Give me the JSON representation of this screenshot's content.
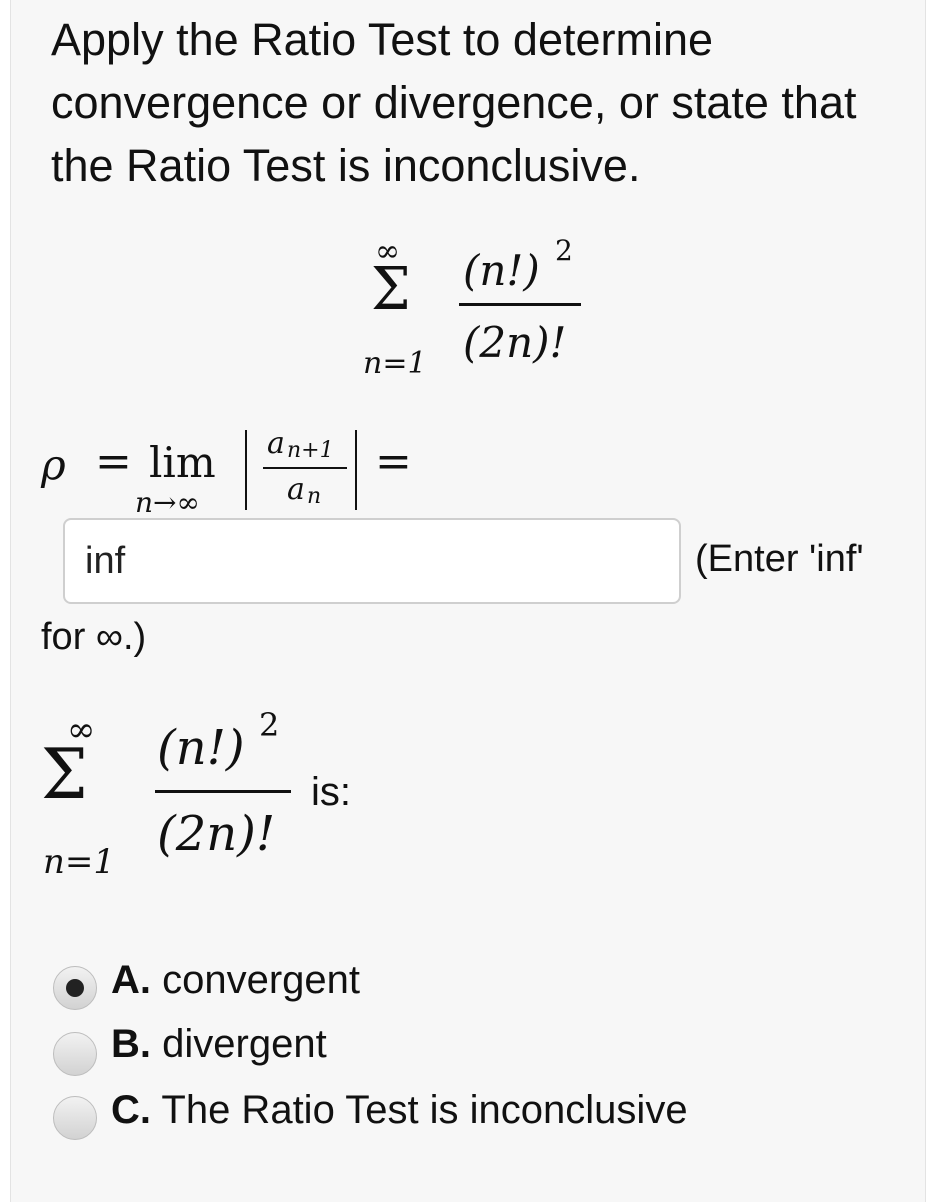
{
  "question": {
    "text": "Apply the Ratio Test to determine convergence or divergence, or state that the Ratio Test is inconclusive."
  },
  "series": {
    "sum_upper": "∞",
    "sum_lower": "n=1",
    "numerator": "(n!)",
    "numerator_exp": "2",
    "denominator": "(2n)!"
  },
  "ratio": {
    "rho": "ρ",
    "equals": "=",
    "lim": "lim",
    "lim_sub": "n→∞",
    "a_num": "a",
    "a_num_sub": "n+1",
    "a_den": "a",
    "a_den_sub": "n",
    "equals_after": "="
  },
  "answer_input": {
    "value": "inf"
  },
  "hint": {
    "part1": "(Enter 'inf'",
    "part2": "for ∞.)"
  },
  "conclusion": {
    "suffix": "is:"
  },
  "options": [
    {
      "letter": "A.",
      "text": "convergent",
      "selected": true
    },
    {
      "letter": "B.",
      "text": "divergent",
      "selected": false
    },
    {
      "letter": "C.",
      "text": "The Ratio Test is inconclusive",
      "selected": false
    }
  ]
}
